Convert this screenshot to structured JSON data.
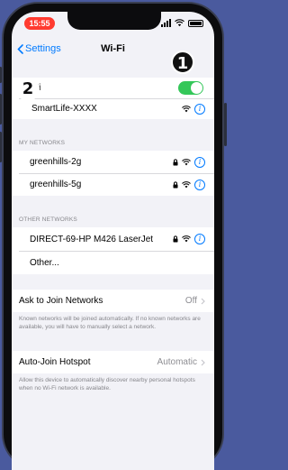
{
  "status_bar": {
    "time": "15:55"
  },
  "navbar": {
    "back_label": "Settings",
    "title": "Wi-Fi"
  },
  "wifi_toggle": {
    "label": "Fi",
    "on": true
  },
  "current_network": {
    "name": "SmartLife-XXXX"
  },
  "my_networks": {
    "header": "MY NETWORKS",
    "items": [
      {
        "name": "greenhills-2g"
      },
      {
        "name": "greenhills-5g"
      }
    ]
  },
  "other_networks": {
    "header": "OTHER NETWORKS",
    "items": [
      {
        "name": "DIRECT-69-HP M426 LaserJet"
      },
      {
        "name": "Other..."
      }
    ]
  },
  "ask_to_join": {
    "label": "Ask to Join Networks",
    "value": "Off",
    "footnote": "Known networks will be joined automatically. If no known networks are available, you will have to manually select a network."
  },
  "auto_join_hotspot": {
    "label": "Auto-Join Hotspot",
    "value": "Automatic",
    "footnote": "Allow this device to automatically discover nearby personal hotspots when no Wi-Fi network is available."
  },
  "annotations": {
    "badge_1": "1",
    "badge_2": "2"
  },
  "colors": {
    "background": "#4a5a9e",
    "accent": "#007aff",
    "toggle_on": "#34c759",
    "time_pill": "#ff3b30"
  },
  "icons": [
    "back-chevron-icon",
    "signal-icon",
    "wifi-icon",
    "battery-icon",
    "lock-icon",
    "info-icon",
    "chevron-right-icon"
  ]
}
